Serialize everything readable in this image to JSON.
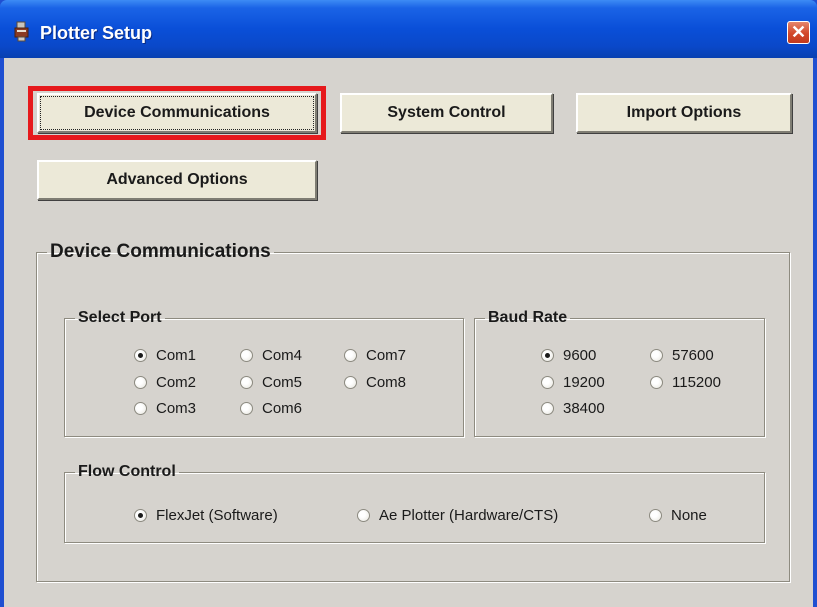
{
  "window": {
    "title": "Plotter Setup",
    "close_glyph": "✕"
  },
  "tabs": {
    "device_communications": "Device Communications",
    "system_control": "System Control",
    "import_options": "Import Options",
    "advanced_options": "Advanced Options"
  },
  "device_communications": {
    "title": "Device Communications",
    "select_port": {
      "title": "Select Port",
      "selected": "Com1",
      "options": [
        "Com1",
        "Com4",
        "Com7",
        "Com2",
        "Com5",
        "Com8",
        "Com3",
        "Com6"
      ]
    },
    "baud_rate": {
      "title": "Baud Rate",
      "selected": "9600",
      "options": [
        "9600",
        "57600",
        "19200",
        "115200",
        "38400"
      ]
    },
    "flow_control": {
      "title": "Flow Control",
      "selected": "FlexJet (Software)",
      "options": [
        "FlexJet (Software)",
        "Ae Plotter (Hardware/CTS)",
        "None"
      ]
    }
  },
  "colors": {
    "title_bar": "#0a4fd8",
    "dialog_background": "#d6d3ce",
    "highlight_box": "#e6191c",
    "close_button": "#d2482a"
  },
  "icons": {
    "title": "plotter-icon",
    "close": "close-icon"
  }
}
